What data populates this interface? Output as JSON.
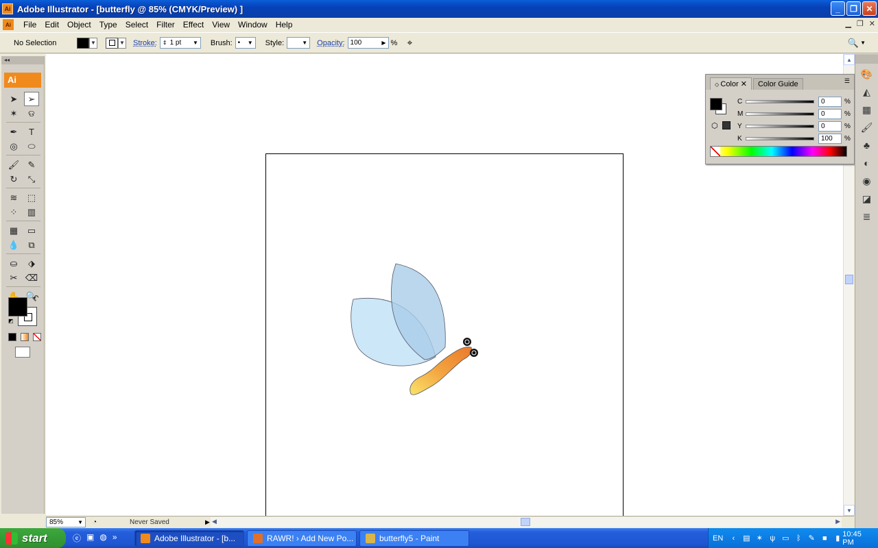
{
  "window": {
    "title": "Adobe Illustrator - [butterfly @ 85% (CMYK/Preview) ]",
    "app_icon": "Ai"
  },
  "menubar": {
    "items": [
      "File",
      "Edit",
      "Object",
      "Type",
      "Select",
      "Filter",
      "Effect",
      "View",
      "Window",
      "Help"
    ]
  },
  "controlbar": {
    "selection_label": "No Selection",
    "stroke_label": "Stroke:",
    "stroke_weight": "1 pt",
    "brush_label": "Brush:",
    "style_label": "Style:",
    "opacity_label": "Opacity:",
    "opacity_value": "100",
    "percent": "%"
  },
  "tools": {
    "logo": "Ai",
    "items": [
      {
        "name": "selection-tool-icon",
        "glyph": "➤"
      },
      {
        "name": "direct-selection-tool-icon",
        "glyph": "➢"
      },
      {
        "name": "magic-wand-tool-icon",
        "glyph": "✶"
      },
      {
        "name": "lasso-tool-icon",
        "glyph": "ଡ"
      },
      {
        "name": "pen-tool-icon",
        "glyph": "✒"
      },
      {
        "name": "type-tool-icon",
        "glyph": "T"
      },
      {
        "name": "spiral-tool-icon",
        "glyph": "◎"
      },
      {
        "name": "ellipse-tool-icon",
        "glyph": "⬭"
      },
      {
        "name": "paintbrush-tool-icon",
        "glyph": "🖌"
      },
      {
        "name": "pencil-tool-icon",
        "glyph": "✎"
      },
      {
        "name": "rotate-tool-icon",
        "glyph": "↻"
      },
      {
        "name": "scale-tool-icon",
        "glyph": "⤡"
      },
      {
        "name": "warp-tool-icon",
        "glyph": "≋"
      },
      {
        "name": "free-transform-tool-icon",
        "glyph": "⬚"
      },
      {
        "name": "symbol-sprayer-tool-icon",
        "glyph": "⁘"
      },
      {
        "name": "column-graph-tool-icon",
        "glyph": "▥"
      },
      {
        "name": "mesh-tool-icon",
        "glyph": "▦"
      },
      {
        "name": "gradient-tool-icon",
        "glyph": "▭"
      },
      {
        "name": "eyedropper-tool-icon",
        "glyph": "💧"
      },
      {
        "name": "blend-tool-icon",
        "glyph": "⧉"
      },
      {
        "name": "live-paint-bucket-tool-icon",
        "glyph": "⛀"
      },
      {
        "name": "live-paint-selection-tool-icon",
        "glyph": "⬗"
      },
      {
        "name": "slice-tool-icon",
        "glyph": "✂"
      },
      {
        "name": "eraser-tool-icon",
        "glyph": "⌫"
      },
      {
        "name": "hand-tool-icon",
        "glyph": "✋"
      },
      {
        "name": "zoom-tool-icon",
        "glyph": "🔍"
      }
    ]
  },
  "color_panel": {
    "tabs": [
      "Color",
      "Color Guide"
    ],
    "channels": [
      {
        "label": "C",
        "value": "0"
      },
      {
        "label": "M",
        "value": "0"
      },
      {
        "label": "Y",
        "value": "0"
      },
      {
        "label": "K",
        "value": "100"
      }
    ],
    "percent": "%"
  },
  "status": {
    "zoom": "85%",
    "message": "Never Saved"
  },
  "taskbar": {
    "start_label": "start",
    "tasks": [
      {
        "label": "Adobe Illustrator - [b...",
        "color": "#f08a1c",
        "active": true
      },
      {
        "label": "RAWR! › Add New Po...",
        "color": "#e0702a",
        "active": false
      },
      {
        "label": "butterfly5 - Paint",
        "color": "#d9b64a",
        "active": false
      }
    ],
    "language": "EN",
    "clock": "10:45 PM"
  },
  "colors": {
    "accent": "#f08a1c",
    "titlebar": "#0a5fd8",
    "wing_light": "#c6e4f6",
    "wing_dark": "#a9cde9",
    "body_orange": "#ef8b32"
  }
}
